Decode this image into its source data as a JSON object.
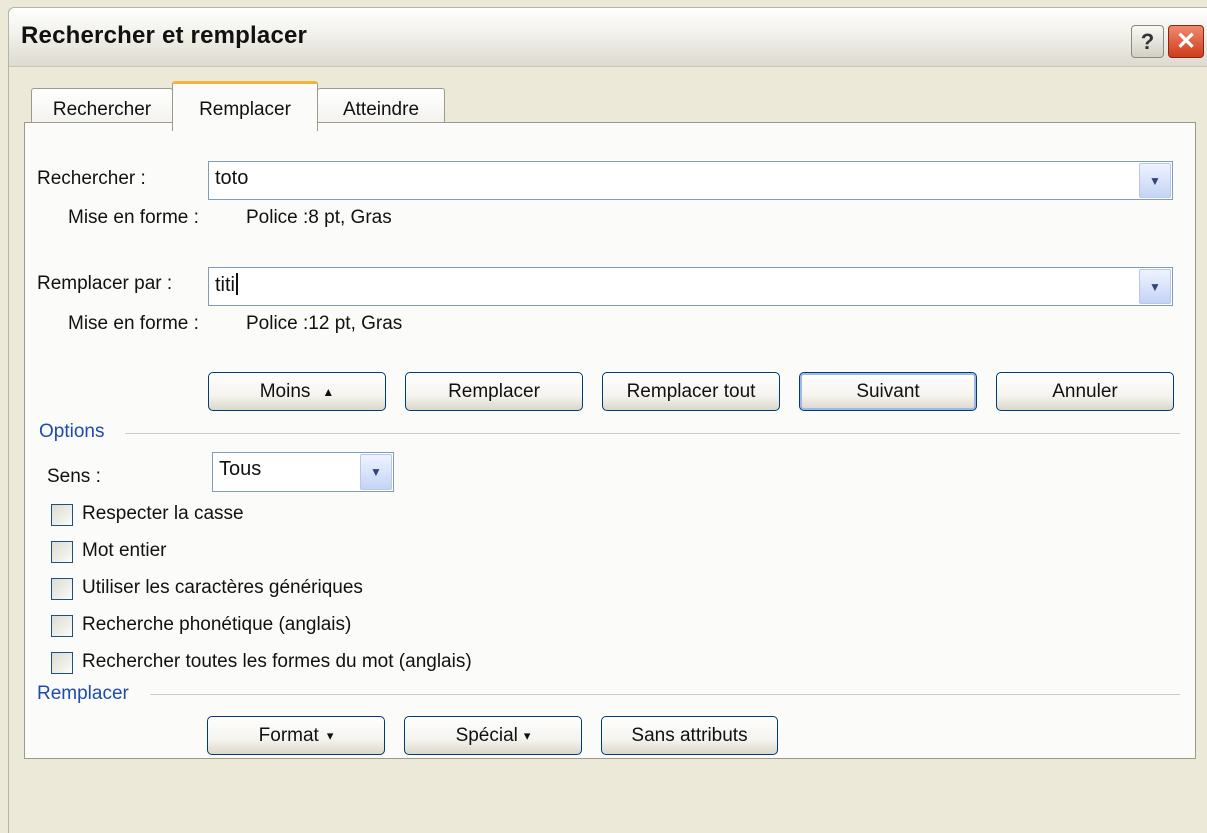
{
  "window": {
    "title": "Rechercher et remplacer",
    "help_label": "?",
    "close_label": "✕"
  },
  "tabs": [
    {
      "label": "Rechercher"
    },
    {
      "label": "Remplacer"
    },
    {
      "label": "Atteindre"
    }
  ],
  "find": {
    "label": "Rechercher :",
    "value": "toto",
    "format_label": "Mise en forme :",
    "format_value": "Police :8 pt, Gras"
  },
  "replace": {
    "label": "Remplacer par :",
    "value": "titi",
    "format_label": "Mise en forme :",
    "format_value": "Police :12 pt, Gras"
  },
  "buttons": {
    "less": "Moins",
    "less_arrow": "▲",
    "replace": "Remplacer",
    "replace_all": "Remplacer tout",
    "next": "Suivant",
    "cancel": "Annuler"
  },
  "options": {
    "title": "Options",
    "direction_label": "Sens :",
    "direction_value": "Tous",
    "checkboxes": [
      {
        "label": "Respecter la casse",
        "checked": false
      },
      {
        "label": "Mot entier",
        "checked": false
      },
      {
        "label": "Utiliser les caractères génériques",
        "checked": false
      },
      {
        "label": "Recherche phonétique (anglais)",
        "checked": false
      },
      {
        "label": "Rechercher toutes les formes du mot (anglais)",
        "checked": false
      }
    ]
  },
  "replace_section": {
    "title": "Remplacer",
    "format_button": "Format",
    "special_button": "Spécial",
    "no_format_button": "Sans attributs"
  },
  "icons": {
    "dropdown_arrow": "chevron-down-icon",
    "menu_arrow": "▾"
  }
}
